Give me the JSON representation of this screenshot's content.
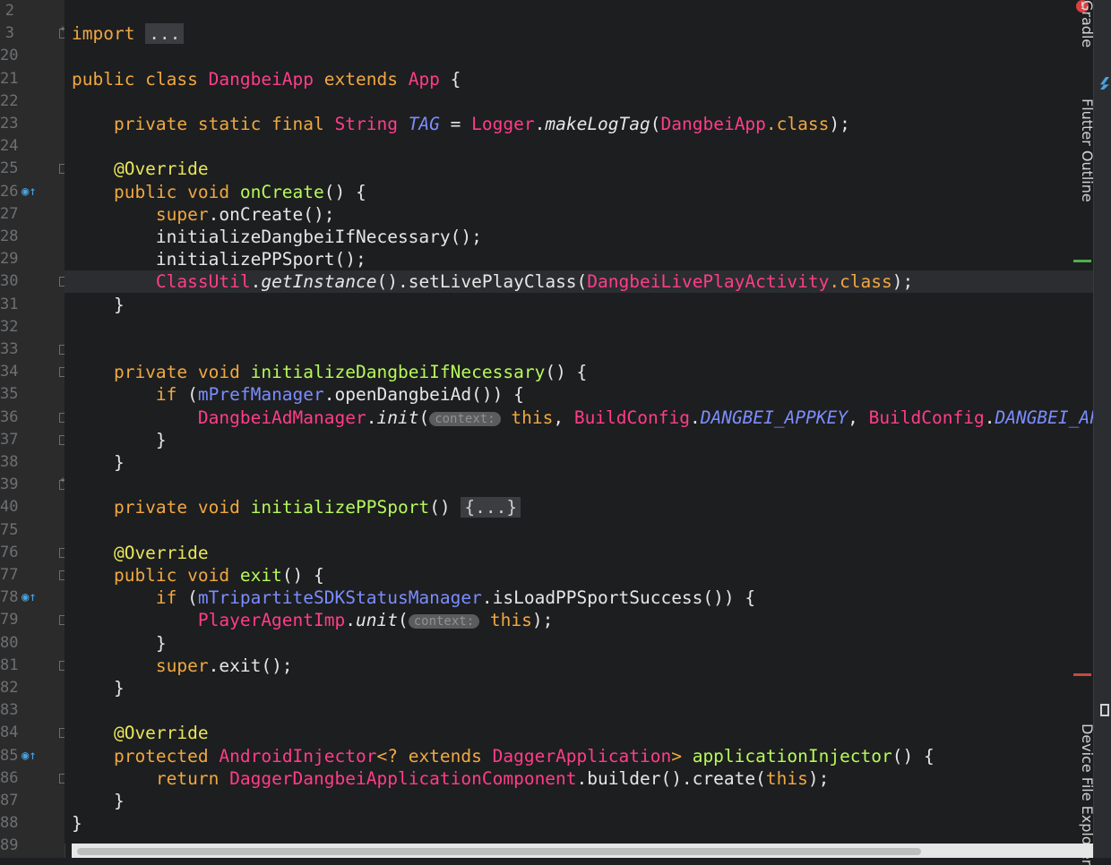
{
  "gutter": {
    "line_numbers": [
      "2",
      "3",
      "20",
      "21",
      "22",
      "23",
      "24",
      "25",
      "26",
      "27",
      "28",
      "29",
      "30",
      "31",
      "32",
      "33",
      "34",
      "35",
      "36",
      "37",
      "38",
      "39",
      "40",
      "75",
      "76",
      "77",
      "78",
      "79",
      "80",
      "81",
      "82",
      "83",
      "84",
      "85",
      "86",
      "87",
      "88",
      "89"
    ]
  },
  "code": {
    "lines": [
      {
        "text": "import ...",
        "tokens": [
          [
            "k",
            "import "
          ],
          [
            "fbox",
            "..."
          ]
        ]
      },
      {
        "text": "",
        "tokens": []
      },
      {
        "text": "public class DangbeiApp extends App {",
        "tokens": [
          [
            "k",
            "public class "
          ],
          [
            "cls",
            "DangbeiApp"
          ],
          [
            "k",
            " extends "
          ],
          [
            "cls",
            "App"
          ],
          [
            "dim",
            " {"
          ]
        ]
      },
      {
        "text": "",
        "tokens": []
      },
      {
        "text": "    private static final String TAG = Logger.makeLogTag(DangbeiApp.class);",
        "tokens": [
          [
            "k",
            "    private static final "
          ],
          [
            "cls",
            "String "
          ],
          [
            "fld it",
            "TAG"
          ],
          [
            "dim",
            " = "
          ],
          [
            "cls",
            "Logger"
          ],
          [
            "dim",
            "."
          ],
          [
            "it",
            "makeLogTag"
          ],
          [
            "dim",
            "("
          ],
          [
            "cls",
            "DangbeiApp"
          ],
          [
            "k",
            ".class"
          ],
          [
            "dim",
            ");"
          ]
        ]
      },
      {
        "text": "",
        "tokens": []
      },
      {
        "text": "    @Override",
        "tokens": [
          [
            "ann",
            "    @Override"
          ]
        ]
      },
      {
        "text": "    public void onCreate() {",
        "tokens": [
          [
            "k",
            "    public void "
          ],
          [
            "mth",
            "onCreate"
          ],
          [
            "dim",
            "() {"
          ]
        ]
      },
      {
        "text": "        super.onCreate();",
        "tokens": [
          [
            "k",
            "        super"
          ],
          [
            "dim",
            ".onCreate();"
          ]
        ]
      },
      {
        "text": "        initializeDangbeiIfNecessary();",
        "tokens": [
          [
            "dim",
            "        initializeDangbeiIfNecessary();"
          ]
        ]
      },
      {
        "text": "        initializePPSport();",
        "tokens": [
          [
            "dim",
            "        initializePPSport();"
          ]
        ]
      },
      {
        "text": "        ClassUtil.getInstance().setLivePlayClass(DangbeiLivePlayActivity.class);",
        "tokens": [
          [
            "cls",
            "        ClassUtil"
          ],
          [
            "dim",
            "."
          ],
          [
            "it",
            "getInstance"
          ],
          [
            "dim",
            "().setLivePlayClass("
          ],
          [
            "cls",
            "DangbeiLivePlayActivity"
          ],
          [
            "k",
            ".class"
          ],
          [
            "dim",
            ");"
          ]
        ]
      },
      {
        "text": "    }",
        "tokens": [
          [
            "dim",
            "    }"
          ]
        ]
      },
      {
        "text": "",
        "tokens": []
      },
      {
        "text": "",
        "tokens": []
      },
      {
        "text": "    private void initializeDangbeiIfNecessary() {",
        "tokens": [
          [
            "k",
            "    private void "
          ],
          [
            "mth",
            "initializeDangbeiIfNecessary"
          ],
          [
            "dim",
            "() {"
          ]
        ]
      },
      {
        "text": "        if (mPrefManager.openDangbeiAd()) {",
        "tokens": [
          [
            "k",
            "        if "
          ],
          [
            "dim",
            "("
          ],
          [
            "fld",
            "mPrefManager"
          ],
          [
            "dim",
            ".openDangbeiAd()) {"
          ]
        ]
      },
      {
        "text": "            DangbeiAdManager.init( context: this, BuildConfig.DANGBEI_APPKEY, BuildConfig.DANGBEI_APP_SEC",
        "tokens": [
          [
            "cls",
            "            DangbeiAdManager"
          ],
          [
            "dim",
            "."
          ],
          [
            "it",
            "init"
          ],
          [
            "dim",
            "("
          ],
          [
            "hint",
            "context:"
          ],
          [
            "k",
            " this"
          ],
          [
            "dim",
            ", "
          ],
          [
            "cls",
            "BuildConfig"
          ],
          [
            "dim",
            "."
          ],
          [
            "fld it",
            "DANGBEI_APPKEY"
          ],
          [
            "dim",
            ", "
          ],
          [
            "cls",
            "BuildConfig"
          ],
          [
            "dim",
            "."
          ],
          [
            "fld it",
            "DANGBEI_APP_SEC"
          ]
        ]
      },
      {
        "text": "        }",
        "tokens": [
          [
            "dim",
            "        }"
          ]
        ]
      },
      {
        "text": "    }",
        "tokens": [
          [
            "dim",
            "    }"
          ]
        ]
      },
      {
        "text": "",
        "tokens": []
      },
      {
        "text": "    private void initializePPSport() {...}",
        "tokens": [
          [
            "k",
            "    private void "
          ],
          [
            "mth",
            "initializePPSport"
          ],
          [
            "dim",
            "() "
          ],
          [
            "fbox",
            "{...}"
          ]
        ]
      },
      {
        "text": "",
        "tokens": []
      },
      {
        "text": "    @Override",
        "tokens": [
          [
            "ann",
            "    @Override"
          ]
        ]
      },
      {
        "text": "    public void exit() {",
        "tokens": [
          [
            "k",
            "    public void "
          ],
          [
            "mth",
            "exit"
          ],
          [
            "dim",
            "() {"
          ]
        ]
      },
      {
        "text": "        if (mTripartiteSDKStatusManager.isLoadPPSportSuccess()) {",
        "tokens": [
          [
            "k",
            "        if "
          ],
          [
            "dim",
            "("
          ],
          [
            "fld",
            "mTripartiteSDKStatusManager"
          ],
          [
            "dim",
            ".isLoadPPSportSuccess()) {"
          ]
        ]
      },
      {
        "text": "            PlayerAgentImp.unit( context: this);",
        "tokens": [
          [
            "cls",
            "            PlayerAgentImp"
          ],
          [
            "dim",
            "."
          ],
          [
            "it",
            "unit"
          ],
          [
            "dim",
            "("
          ],
          [
            "hint",
            "context:"
          ],
          [
            "k",
            " this"
          ],
          [
            "dim",
            ");"
          ]
        ]
      },
      {
        "text": "        }",
        "tokens": [
          [
            "dim",
            "        }"
          ]
        ]
      },
      {
        "text": "        super.exit();",
        "tokens": [
          [
            "k",
            "        super"
          ],
          [
            "dim",
            ".exit();"
          ]
        ]
      },
      {
        "text": "    }",
        "tokens": [
          [
            "dim",
            "    }"
          ]
        ]
      },
      {
        "text": "",
        "tokens": []
      },
      {
        "text": "    @Override",
        "tokens": [
          [
            "ann",
            "    @Override"
          ]
        ]
      },
      {
        "text": "    protected AndroidInjector<? extends DaggerApplication> applicationInjector() {",
        "tokens": [
          [
            "k",
            "    protected "
          ],
          [
            "cls",
            "AndroidInjector"
          ],
          [
            "k",
            "<? extends "
          ],
          [
            "cls",
            "DaggerApplication"
          ],
          [
            "k",
            "> "
          ],
          [
            "mth",
            "applicationInjector"
          ],
          [
            "dim",
            "() {"
          ]
        ]
      },
      {
        "text": "        return DaggerDangbeiApplicationComponent.builder().create(this);",
        "tokens": [
          [
            "k",
            "        return "
          ],
          [
            "cls",
            "DaggerDangbeiApplicationComponent"
          ],
          [
            "dim",
            ".builder().create("
          ],
          [
            "k",
            "this"
          ],
          [
            "dim",
            ");"
          ]
        ]
      },
      {
        "text": "    }",
        "tokens": [
          [
            "dim",
            "    }"
          ]
        ]
      },
      {
        "text": "}",
        "tokens": [
          [
            "dim",
            "}"
          ]
        ]
      },
      {
        "text": "",
        "tokens": []
      }
    ]
  },
  "right_tool_windows": [
    "Gradle",
    "Flutter Outline",
    "Device File Explorer"
  ],
  "colors": {
    "keyword": "#f0a842",
    "class": "#ff3d89",
    "method": "#b6f95a",
    "field": "#7b8dff",
    "annotation": "#e7e55a"
  }
}
